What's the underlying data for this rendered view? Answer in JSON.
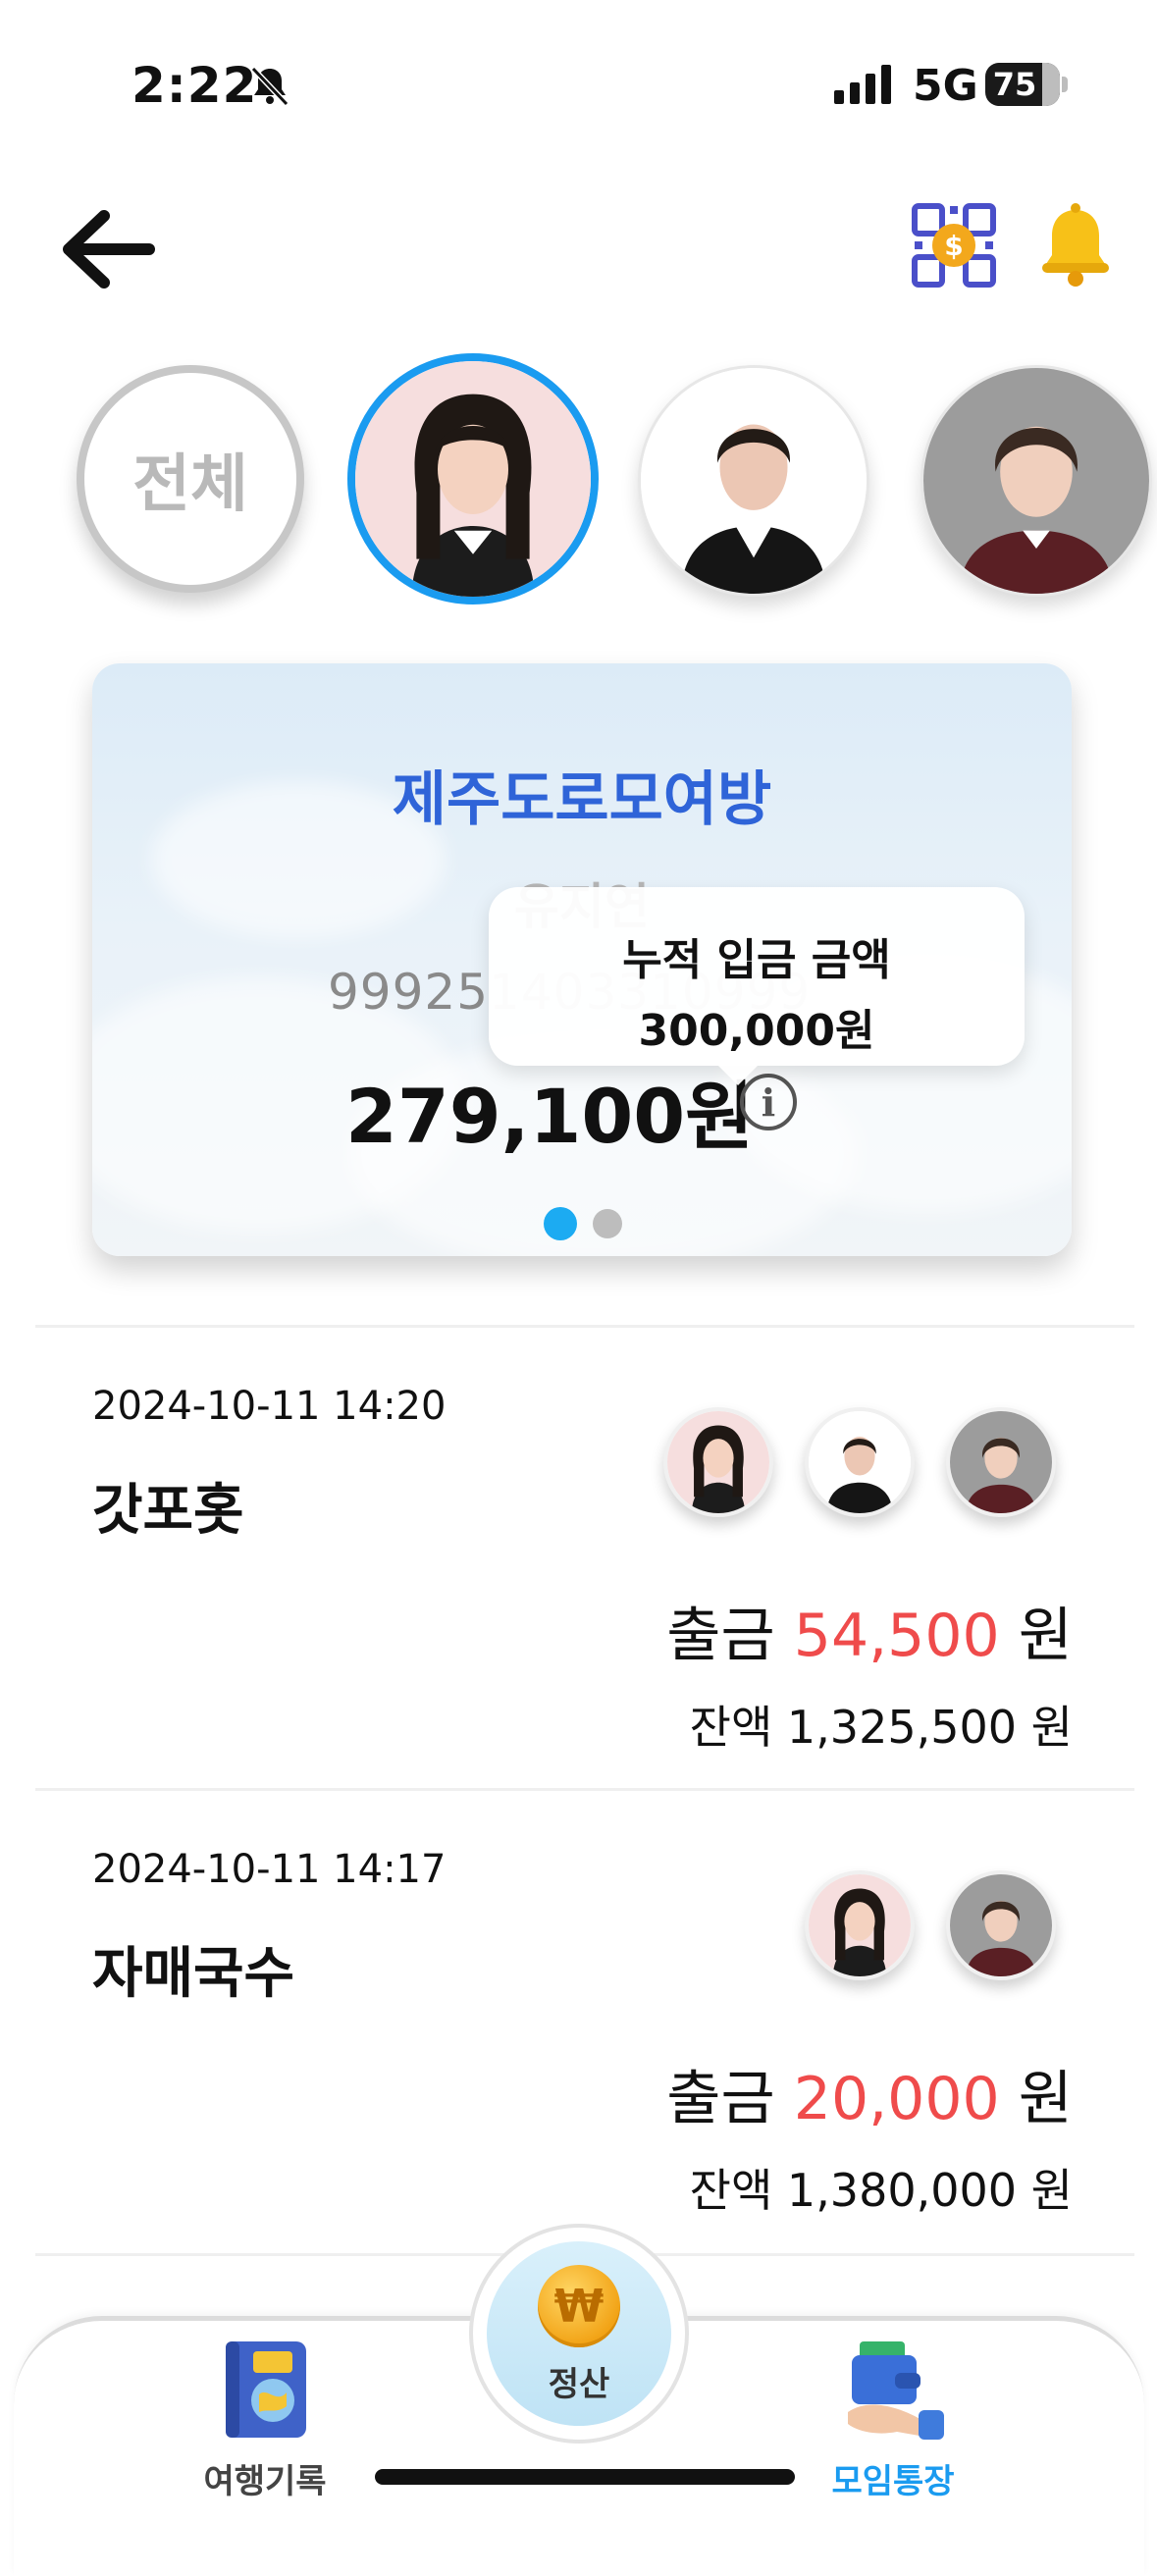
{
  "status_bar": {
    "time": "2:22",
    "network": "5G",
    "battery": "75"
  },
  "members": {
    "all_label": "전체"
  },
  "card": {
    "title": "제주도로모여방",
    "owner": "유지연",
    "account": "99925",
    "account_faded": "1403310999",
    "balance": "279,100원",
    "tooltip_label": "누적 입금 금액",
    "tooltip_value": "300,000원",
    "info_icon": "i"
  },
  "transactions": [
    {
      "date": "2024-10-11 14:20",
      "name": "갓포홋",
      "type": "출금",
      "amount": "54,500",
      "unit": "원",
      "balance_label": "잔액",
      "balance": "1,325,500",
      "balance_unit": "원"
    },
    {
      "date": "2024-10-11 14:17",
      "name": "자매국수",
      "type": "출금",
      "amount": "20,000",
      "unit": "원",
      "balance_label": "잔액",
      "balance": "1,380,000",
      "balance_unit": "원"
    }
  ],
  "nav": {
    "travel": "여행기록",
    "settle": "정산",
    "settle_icon": "₩",
    "meeting": "모임통장"
  },
  "colors": {
    "accent": "#1a9bf0",
    "title_blue": "#2f64d8",
    "withdraw_red": "#ef4b4b"
  }
}
